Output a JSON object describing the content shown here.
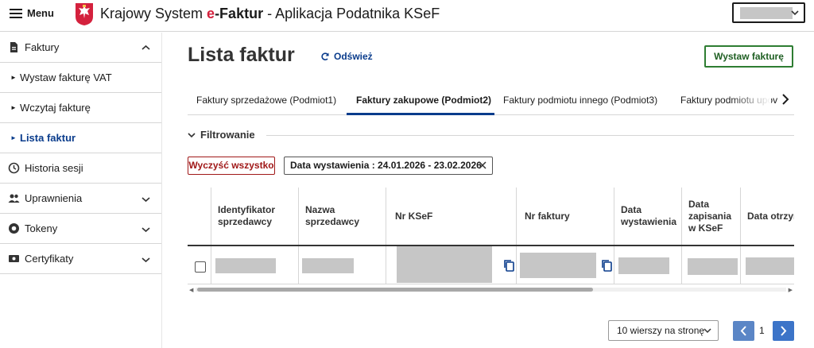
{
  "header": {
    "menu_label": "Menu",
    "app_title_prefix": "Krajowy System ",
    "app_title_e": "e",
    "app_title_faktur": "-Faktur",
    "app_title_suffix": " - Aplikacja Podatnika KSeF"
  },
  "sidebar": {
    "items": [
      {
        "label": "Faktury",
        "icon": "document-icon"
      },
      {
        "label": "Wystaw fakturę VAT"
      },
      {
        "label": "Wczytaj fakturę"
      },
      {
        "label": "Lista faktur"
      },
      {
        "label": "Historia sesji",
        "icon": "clock-icon"
      },
      {
        "label": "Uprawnienia",
        "icon": "users-icon"
      },
      {
        "label": "Tokeny",
        "icon": "token-icon"
      },
      {
        "label": "Certyfikaty",
        "icon": "certificate-icon"
      }
    ],
    "active": "Lista faktur"
  },
  "main": {
    "title": "Lista faktur",
    "refresh_label": "Odśwież",
    "issue_button": "Wystaw fakturę",
    "tabs": [
      {
        "label": "Faktury sprzedażowe (Podmiot1)"
      },
      {
        "label": "Faktury zakupowe (Podmiot2)"
      },
      {
        "label": "Faktury podmiotu innego (Podmiot3)"
      },
      {
        "label": "Faktury podmiotu upov"
      }
    ],
    "active_tab": "Faktury zakupowe (Podmiot2)",
    "filter_label": "Filtrowanie",
    "clear_all": "Wyczyść wszystko",
    "date_chip": "Data wystawienia : 24.01.2026 - 23.02.2026"
  },
  "table": {
    "columns": [
      "Identyfikator sprzedawcy",
      "Nazwa sprzedawcy",
      "Nr KSeF",
      "Nr faktury",
      "Data wystawienia",
      "Data zapisania w KSeF",
      "Data otrzymania"
    ]
  },
  "pagination": {
    "rows_per_page": "10 wierszy na stronę",
    "current_page": "1"
  },
  "colors": {
    "primary": "#0a3c8c",
    "success": "#2e7d32",
    "danger": "#a01818",
    "pager": "#3c74c8"
  }
}
